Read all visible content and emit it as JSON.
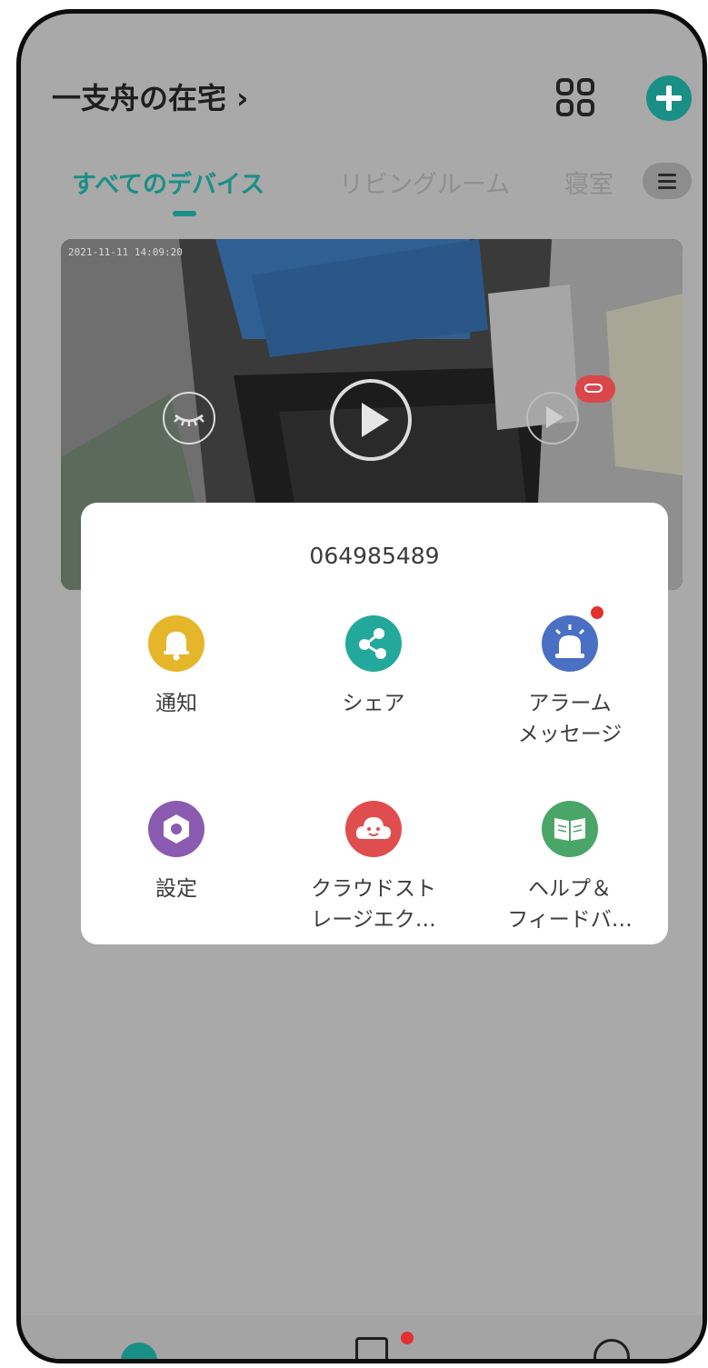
{
  "header": {
    "home_name": "一支舟の在宅 ›"
  },
  "tabs": [
    {
      "label": "すべてのデバイス",
      "active": true
    },
    {
      "label": "リビングルーム",
      "active": false
    },
    {
      "label": "寝室",
      "active": false
    }
  ],
  "camera": {
    "timestamp": "2021-11-11 14:09:20"
  },
  "popup": {
    "device_id": "064985489",
    "items": [
      {
        "label": "通知",
        "icon": "bell-icon",
        "color": "#e6b62a"
      },
      {
        "label": "シェア",
        "icon": "share-icon",
        "color": "#22a99b"
      },
      {
        "label": "アラーム\nメッセージ",
        "icon": "alarm-siren-icon",
        "color": "#4a70c4",
        "badge": true
      },
      {
        "label": "設定",
        "icon": "gear-icon",
        "color": "#8a5bb0"
      },
      {
        "label": "クラウドスト\nレージエク…",
        "icon": "cloud-icon",
        "color": "#e04d4f"
      },
      {
        "label": "ヘルプ＆\nフィードバ…",
        "icon": "book-icon",
        "color": "#4aa668"
      }
    ]
  },
  "colors": {
    "accent": "#1a8f86",
    "overlay": "#a9a9a9",
    "badge_red": "#e2312f"
  }
}
